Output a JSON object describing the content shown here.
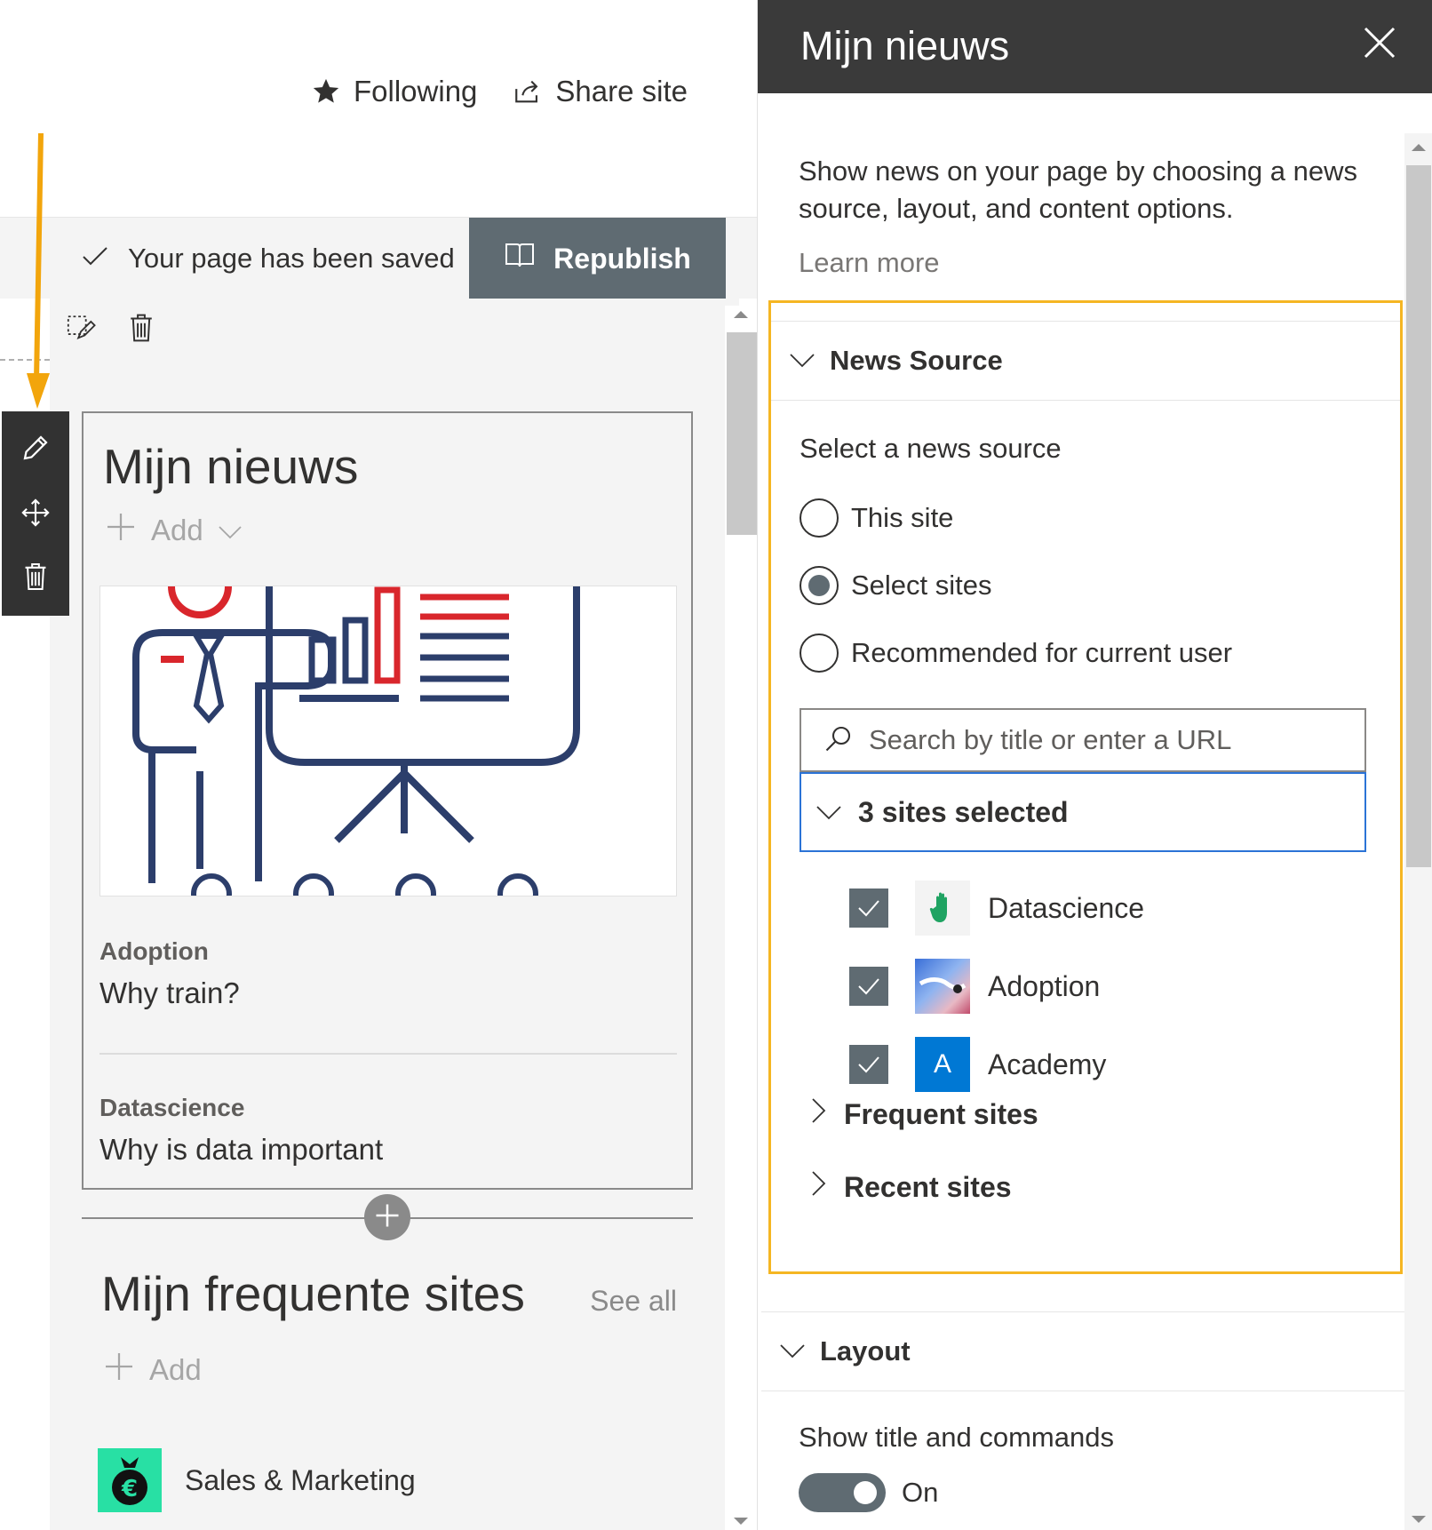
{
  "site_header": {
    "following_label": "Following",
    "share_label": "Share site"
  },
  "status_bar": {
    "saved_text": "Your page has been saved",
    "republish_label": "Republish"
  },
  "news_webpart": {
    "title": "Mijn nieuws",
    "add_label": "Add",
    "items": [
      {
        "site": "Adoption",
        "title": "Why train?"
      },
      {
        "site": "Datascience",
        "title": "Why is data important"
      }
    ]
  },
  "frequent_webpart": {
    "title": "Mijn frequente sites",
    "add_label": "Add",
    "see_all_label": "See all",
    "sites": [
      {
        "name": "Sales & Marketing"
      }
    ]
  },
  "pane": {
    "title": "Mijn nieuws",
    "description": "Show news on your page by choosing a news source, layout, and content options.",
    "learn_more": "Learn more",
    "news_source": {
      "heading": "News Source",
      "label": "Select a news source",
      "options": [
        {
          "label": "This site",
          "selected": false
        },
        {
          "label": "Select sites",
          "selected": true
        },
        {
          "label": "Recommended for current user",
          "selected": false
        }
      ],
      "search_placeholder": "Search by title or enter a URL",
      "selected_summary": "3 sites selected",
      "selected_sites": [
        {
          "name": "Datascience",
          "checked": true
        },
        {
          "name": "Adoption",
          "checked": true
        },
        {
          "name": "Academy",
          "checked": true,
          "logo_letter": "A",
          "logo_color": "#0078d4"
        }
      ],
      "frequent_sites_label": "Frequent sites",
      "recent_sites_label": "Recent sites"
    },
    "layout": {
      "heading": "Layout",
      "show_title_label": "Show title and commands",
      "toggle_state": "On"
    }
  },
  "colors": {
    "accent_highlight": "#f5b623",
    "republish_bg": "#5f6b72",
    "pane_header_bg": "#3a3a3a",
    "selected_border": "#2b73d6",
    "arrow": "#f2a50c"
  }
}
